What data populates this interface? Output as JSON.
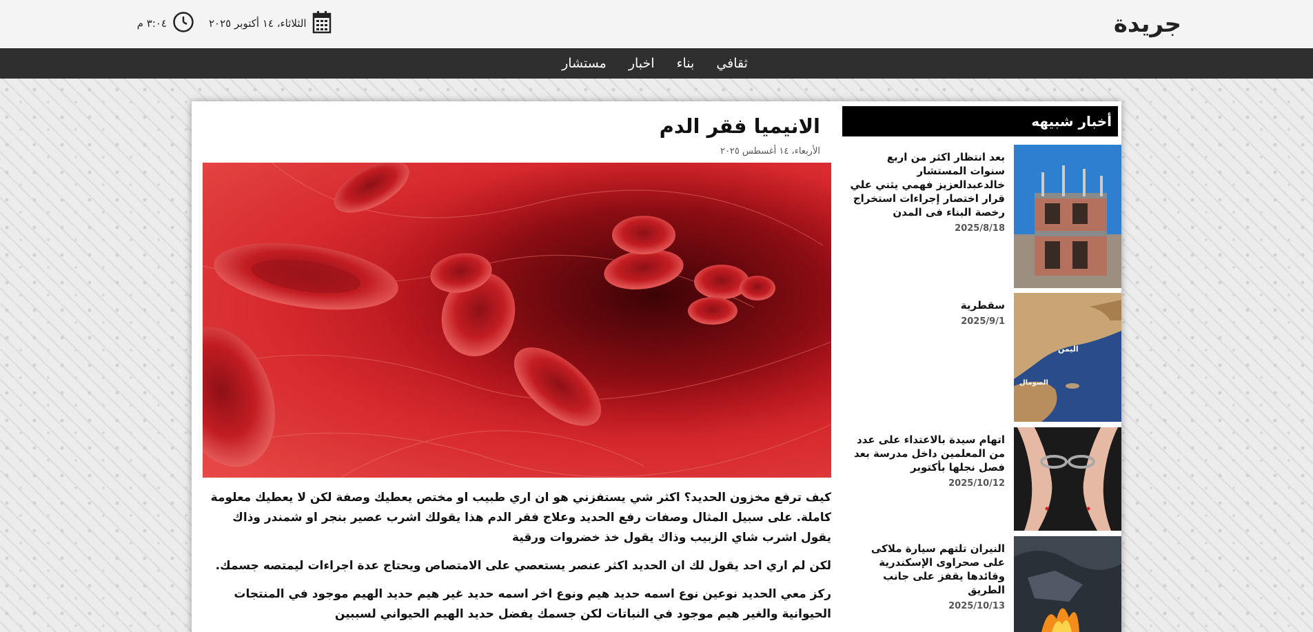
{
  "header": {
    "logo": "جريدة",
    "date": "الثلاثاء، ١٤ أكتوبر ٢٠٢٥",
    "time": "٣:٠٤ م"
  },
  "nav": {
    "items": [
      "ثقافي",
      "بناء",
      "اخبار",
      "مستشار"
    ]
  },
  "article": {
    "title": "الانيميا فقر الدم",
    "date": "الأربعاء، ١٤ أغسطس ٢٠٢٥",
    "paragraphs": [
      "كيف ترفع مخزون الحديد؟ اكثر شي يستفزني هو ان اري طبيب او مختص يعطيك وصفة لكن لا يعطيك معلومة كاملة. على سبيل المثال وصفات رفع الحديد وعلاج فقر الدم هذا يقولك اشرب عصير بنجر او شمندر وذاك يقول اشرب شاي الزبيب وذاك يقول خذ خضروات ورقية",
      "لكن لم اري احد يقول لك ان الحديد اكثر عنصر يستعصي على الامتصاص ويحتاج عدة اجراءات ليمتصه جسمك.",
      "ركز معي الحديد نوعين نوع اسمه حديد هيم ونوع اخر اسمه حديد غير هيم حديد الهيم موجود في المنتجات الحيوانية والغير هيم موجود في النباتات لكن جسمك يفضل حديد الهيم الحيواني لسببين"
    ]
  },
  "sidebar": {
    "heading": "أخبار شبيهه",
    "items": [
      {
        "title": "بعد انتظار اكثر من اربع سنوات المستشار خالدعبدالعزيز فهمي يثني علي قرار اختصار إجراءات استخراج رخصة البناء فى المدن",
        "date": "2025/8/18"
      },
      {
        "title": "سقطرية",
        "date": "2025/9/1"
      },
      {
        "title": "اتهام سيدة بالاعتداء على عدد من المعلمين داخل مدرسة بعد فصل نجلها بأكتوبر",
        "date": "2025/10/12"
      },
      {
        "title": "النيران تلتهم سيارة ملاكى على صحراوى الإسكندرية وقائدها يقفز على جانب الطريق",
        "date": "2025/10/13"
      }
    ],
    "map_labels": {
      "yemen": "اليمن",
      "somalia": "الصومال"
    }
  }
}
